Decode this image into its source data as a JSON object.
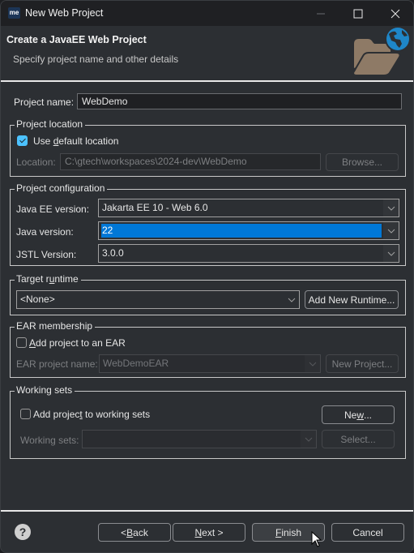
{
  "window": {
    "app_icon_text": "me",
    "title": "New Web Project",
    "controls": {
      "minimize": "minimize-icon",
      "maximize": "maximize-icon",
      "close": "close-icon"
    }
  },
  "header": {
    "title": "Create a JavaEE Web Project",
    "subtitle": "Specify project name and other details",
    "icon": "web-project-folder-icon"
  },
  "project_name": {
    "label": "Project name:",
    "value": "WebDemo"
  },
  "project_location": {
    "legend": "Project location",
    "use_default": {
      "label_pre": "Use ",
      "label_mnemonic": "d",
      "label_post": "efault location",
      "checked": true
    },
    "location_label": "Location:",
    "location_value": "C:\\gtech\\workspaces\\2024-dev\\WebDemo",
    "browse_label": "Browse..."
  },
  "project_configuration": {
    "legend": "Project configuration",
    "javaee": {
      "label": "Java EE version:",
      "value": "Jakarta EE 10 - Web 6.0"
    },
    "java": {
      "label": "Java version:",
      "value": "22"
    },
    "jstl": {
      "label": "JSTL Version:",
      "value": "3.0.0"
    }
  },
  "target_runtime": {
    "legend_pre": "Target r",
    "legend_mnemonic": "u",
    "legend_post": "ntime",
    "value": "<None>",
    "add_runtime_label": "Add New Runtime..."
  },
  "ear_membership": {
    "legend": "EAR membership",
    "add_to_ear": {
      "label_mnemonic": "A",
      "label_post": "dd project to an EAR",
      "checked": false
    },
    "ear_name_label": "EAR project name:",
    "ear_name_value": "WebDemoEAR",
    "new_project_label": "New Project..."
  },
  "working_sets": {
    "legend": "Working sets",
    "add_to_ws": {
      "label_pre": "Add projec",
      "label_mnemonic": "t",
      "label_post": " to working sets",
      "checked": false
    },
    "new_label_pre": "Ne",
    "new_label_mnemonic": "w",
    "new_label_post": "...",
    "ws_label": "Working sets:",
    "ws_value": "",
    "select_label": "Select..."
  },
  "footer": {
    "help_icon": "?",
    "back": {
      "pre": "< ",
      "mnemonic": "B",
      "post": "ack"
    },
    "next": {
      "mnemonic": "N",
      "post": "ext >"
    },
    "finish": {
      "mnemonic": "F",
      "post": "inish"
    },
    "cancel": "Cancel"
  }
}
